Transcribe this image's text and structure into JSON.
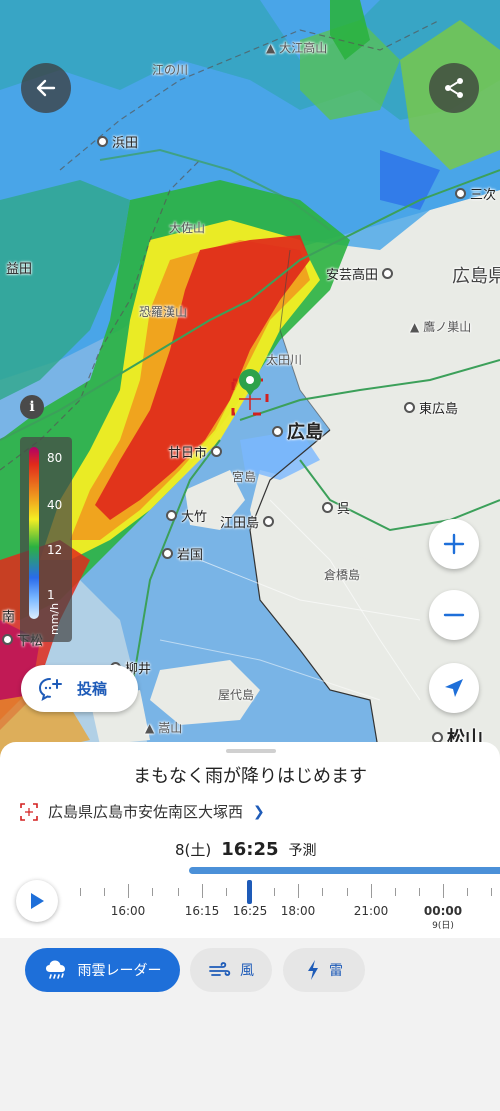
{
  "map": {
    "places": [
      {
        "name": "浜田",
        "kind": "city"
      },
      {
        "name": "益田",
        "kind": "plain"
      },
      {
        "name": "江の川",
        "kind": "faded"
      },
      {
        "name": "大江高山",
        "kind": "faded"
      },
      {
        "name": "三次",
        "kind": "city"
      },
      {
        "name": "大佐山",
        "kind": "faded"
      },
      {
        "name": "安芸高田",
        "kind": "city"
      },
      {
        "name": "広島県",
        "kind": "region"
      },
      {
        "name": "恐羅漢山",
        "kind": "faded"
      },
      {
        "name": "鷹ノ巣山",
        "kind": "faded"
      },
      {
        "name": "太田川",
        "kind": "faded"
      },
      {
        "name": "東広島",
        "kind": "city"
      },
      {
        "name": "広島",
        "kind": "major"
      },
      {
        "name": "廿日市",
        "kind": "city"
      },
      {
        "name": "宮島",
        "kind": "faded"
      },
      {
        "name": "呉",
        "kind": "city"
      },
      {
        "name": "大竹",
        "kind": "city"
      },
      {
        "name": "江田島",
        "kind": "city"
      },
      {
        "name": "岩国",
        "kind": "city"
      },
      {
        "name": "倉橋島",
        "kind": "faded"
      },
      {
        "name": "南",
        "kind": "plain"
      },
      {
        "name": "下松",
        "kind": "city"
      },
      {
        "name": "柳井",
        "kind": "city"
      },
      {
        "name": "屋代島",
        "kind": "faded"
      },
      {
        "name": "嵩山",
        "kind": "faded"
      },
      {
        "name": "松山",
        "kind": "major"
      }
    ],
    "legend": {
      "ticks": [
        "80",
        "40",
        "12",
        "1"
      ],
      "unit": "mm/h"
    },
    "info_glyph": "i",
    "post_button_label": "投稿",
    "icons": {
      "back": "arrow-left-icon",
      "share": "share-icon",
      "zoom_in": "plus-icon",
      "zoom_out": "minus-icon",
      "locate": "navigation-arrow-icon",
      "post": "comment-plus-icon",
      "marker": "location-pin-icon"
    }
  },
  "sheet": {
    "headline": "まもなく雨が降りはじめます",
    "location": "広島県広島市安佐南区大塚西",
    "date": "8(土)",
    "time": "16:25",
    "forecast": "予測",
    "timeline": {
      "labels": [
        {
          "text": "16:00",
          "bold": false
        },
        {
          "text": "16:15",
          "bold": false
        },
        {
          "text": "16:25",
          "bold": false
        },
        {
          "text": "18:00",
          "bold": false
        },
        {
          "text": "21:00",
          "bold": false
        },
        {
          "text": "00:00",
          "bold": true
        }
      ],
      "next_day": "9(日)",
      "current_label": "16:25"
    }
  },
  "tabs": [
    {
      "label": "雨雲レーダー",
      "icon": "rain-cloud-icon",
      "active": true
    },
    {
      "label": "風",
      "icon": "wind-icon",
      "active": false
    },
    {
      "label": "雷",
      "icon": "lightning-icon",
      "active": false
    }
  ],
  "colors": {
    "accent": "#1e6fd9",
    "sea": "#79b4e6",
    "land": "#e9ebe6",
    "rain_heavy": "#e02a1b",
    "rain_mid": "#f4ee23",
    "rain_light": "#2bb240"
  }
}
